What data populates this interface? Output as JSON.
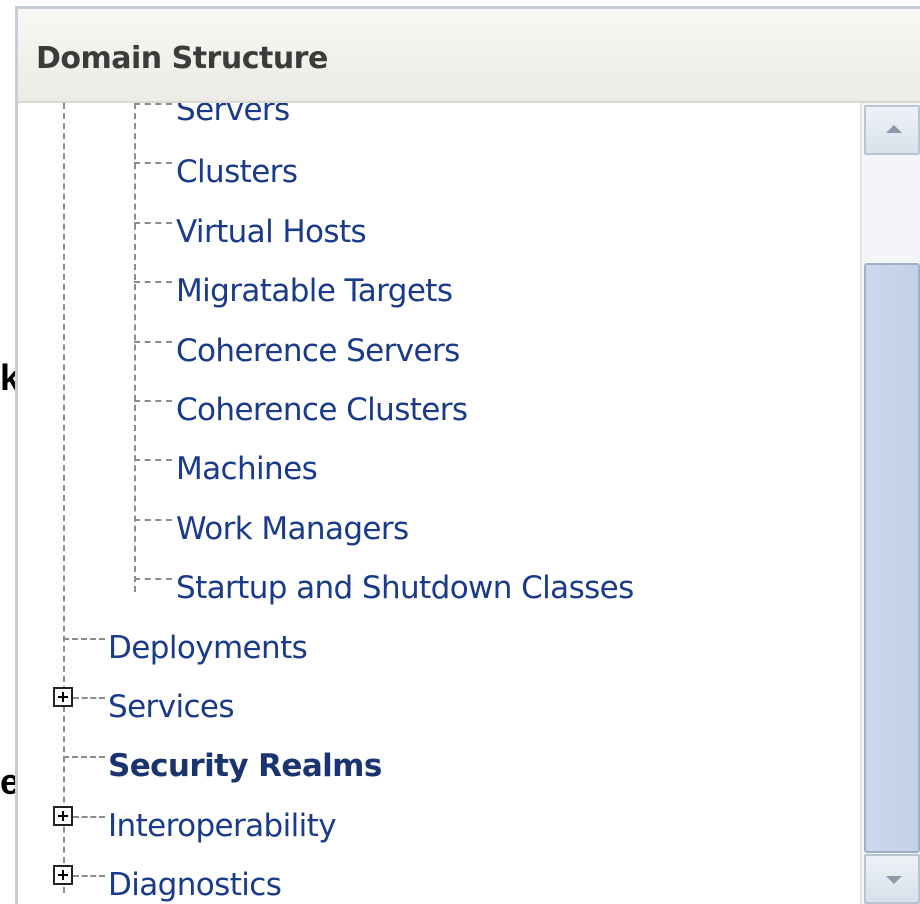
{
  "panel": {
    "title": "Domain Structure"
  },
  "edge_fragments": [
    "kt",
    "er"
  ],
  "tree": {
    "children_environment": [
      {
        "label": "Servers"
      },
      {
        "label": "Clusters"
      },
      {
        "label": "Virtual Hosts"
      },
      {
        "label": "Migratable Targets"
      },
      {
        "label": "Coherence Servers"
      },
      {
        "label": "Coherence Clusters"
      },
      {
        "label": "Machines"
      },
      {
        "label": "Work Managers"
      },
      {
        "label": "Startup and Shutdown Classes"
      }
    ],
    "top_level": [
      {
        "label": "Deployments",
        "expandable": false,
        "bold": false
      },
      {
        "label": "Services",
        "expandable": true,
        "bold": false
      },
      {
        "label": "Security Realms",
        "expandable": false,
        "bold": true
      },
      {
        "label": "Interoperability",
        "expandable": true,
        "bold": false
      },
      {
        "label": "Diagnostics",
        "expandable": true,
        "bold": false
      }
    ]
  },
  "icons": {
    "expand": "plus-box-icon",
    "scroll_up": "arrow-up-icon",
    "scroll_down": "arrow-down-icon"
  }
}
